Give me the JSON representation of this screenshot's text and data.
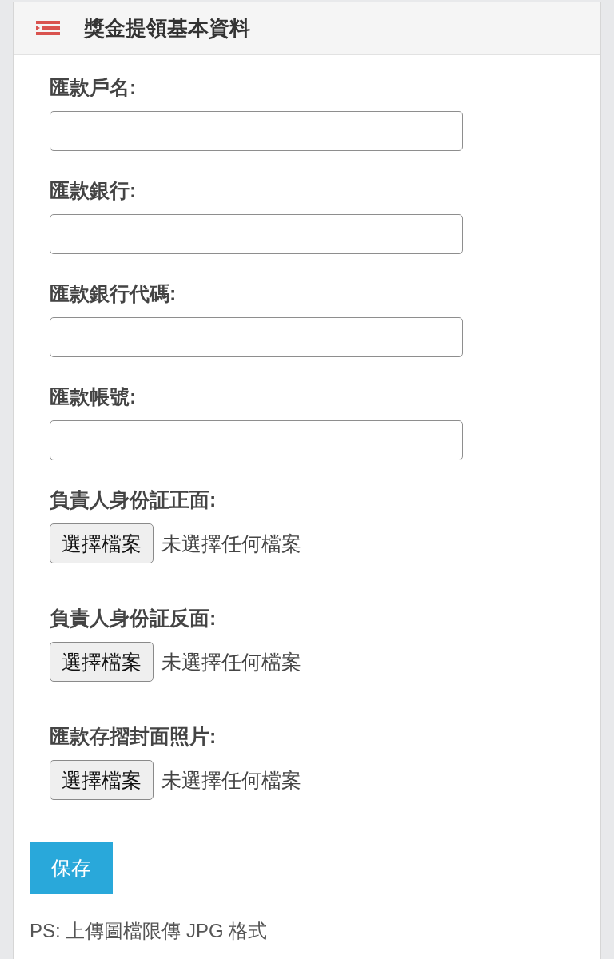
{
  "panel": {
    "title": "獎金提領基本資料"
  },
  "fields": [
    {
      "kind": "text",
      "label": "匯款戶名:"
    },
    {
      "kind": "text",
      "label": "匯款銀行:"
    },
    {
      "kind": "text",
      "label": "匯款銀行代碼:"
    },
    {
      "kind": "text",
      "label": "匯款帳號:"
    },
    {
      "kind": "file",
      "label": "負責人身份証正面:",
      "button": "選擇檔案",
      "status": "未選擇任何檔案"
    },
    {
      "kind": "file",
      "label": "負責人身份証反面:",
      "button": "選擇檔案",
      "status": "未選擇任何檔案"
    },
    {
      "kind": "file",
      "label": "匯款存摺封面照片:",
      "button": "選擇檔案",
      "status": "未選擇任何檔案"
    }
  ],
  "save_button": "保存",
  "note": "PS: 上傳圖檔限傳 JPG 格式"
}
